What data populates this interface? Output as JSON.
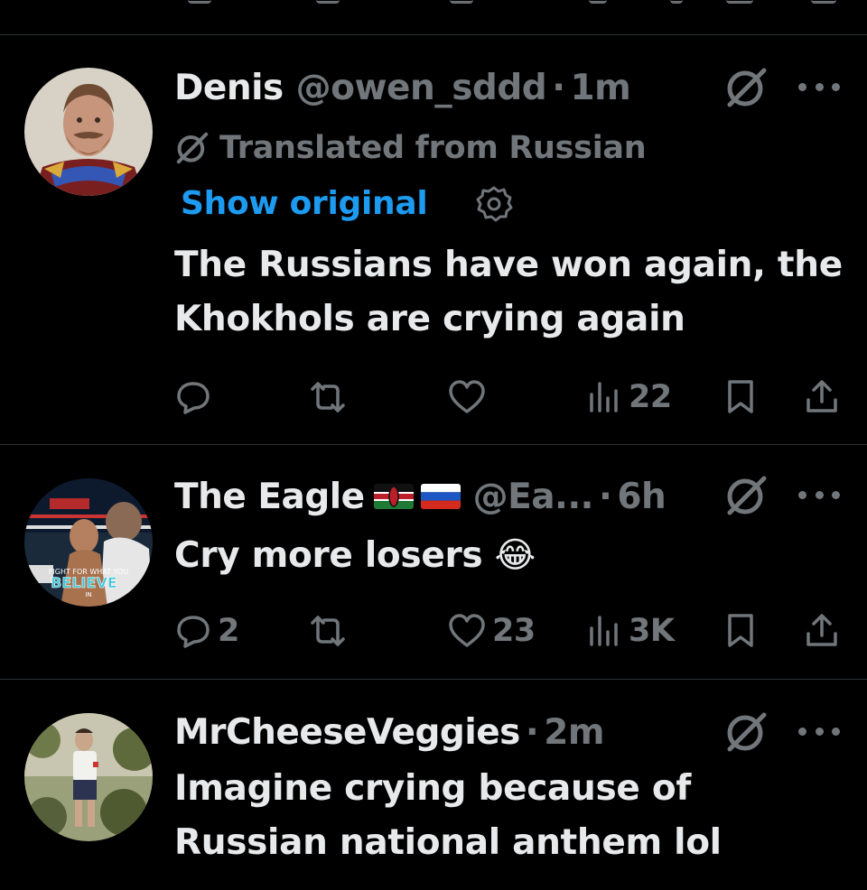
{
  "colors": {
    "background": "#000000",
    "text": "#e7e9ea",
    "muted": "#71767b",
    "link": "#1d9bf0",
    "divider": "#2f3336"
  },
  "tweets": [
    {
      "name": "Denis",
      "handle": "@owen_sddd",
      "separator": "·",
      "time": "1m",
      "translated_label": "Translated from Russian",
      "show_original": "Show original",
      "text": "The Russians have won again, the Khokhols are crying again",
      "actions": {
        "reply": "",
        "retweet": "",
        "like": "",
        "views": "22"
      },
      "icons": [
        "reply-icon",
        "retweet-icon",
        "like-icon",
        "views-icon",
        "bookmark-icon",
        "share-icon"
      ]
    },
    {
      "name": "The Eagle",
      "handle": "@Ea...",
      "separator": "·",
      "time": "6h",
      "text": "Cry more losers",
      "emoji": "😂",
      "avatar_text_1": "FIGHT FOR WHAT YOU",
      "avatar_text_2": "BELIEVE",
      "avatar_text_3": "IN",
      "actions": {
        "reply": "2",
        "retweet": "",
        "like": "23",
        "views": "3K"
      }
    },
    {
      "name": "MrCheeseVeggies",
      "separator": "·",
      "time": "2m",
      "text": "Imagine crying because of Russian national anthem lol"
    }
  ]
}
